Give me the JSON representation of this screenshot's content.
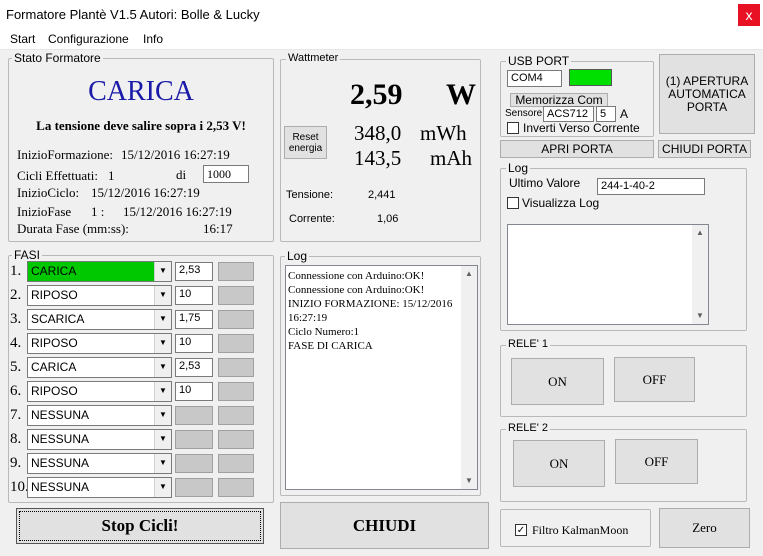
{
  "window": {
    "title": "Formatore Plantè V1.5 Autori: Bolle & Lucky",
    "close": "x"
  },
  "menu": [
    "Start",
    "Configurazione",
    "Info"
  ],
  "stato": {
    "title": "Stato Formatore",
    "status": "CARICA",
    "message": "La tensione deve salire sopra i 2,53 V!",
    "inizio_formazione_label": "InizioFormazione:",
    "inizio_formazione_value": "15/12/2016 16:27:19",
    "cicli_label": "Cicli Effettuati:",
    "cicli_value": "1",
    "cicli_di": "di",
    "cicli_total": "1000",
    "inizio_ciclo_label": "InizioCiclo:",
    "inizio_ciclo_value": "15/12/2016 16:27:19",
    "inizio_fase_label": "InizioFase",
    "inizio_fase_num": "1 :",
    "inizio_fase_value": "15/12/2016 16:27:19",
    "durata_label": "Durata Fase (mm:ss):",
    "durata_value": "16:17"
  },
  "wattmeter": {
    "title": "Wattmeter",
    "power": "2,59",
    "power_unit": "W",
    "reset_label": "Reset energia",
    "energy": "348,0",
    "energy_unit": "mWh",
    "charge": "143,5",
    "charge_unit": "mAh",
    "tensione_label": "Tensione:",
    "tensione_value": "2,441",
    "corrente_label": "Corrente:",
    "corrente_value": "1,06"
  },
  "usb": {
    "title": "USB PORT",
    "port": "COM4",
    "status_color": "#00e000",
    "memorizza": "Memorizza Com",
    "sensore_label": "Sensore",
    "sensore_value": "ACS712",
    "sensore_num": "5",
    "sensore_unit": "A",
    "inverti_label": "Inverti Verso Corrente",
    "apertura_label": "(1) APERTURA AUTOMATICA PORTA",
    "apri_label": "APRI PORTA",
    "chiudi_porta_label": "CHIUDI PORTA"
  },
  "log_right": {
    "title": "Log",
    "ultimo_label": "Ultimo Valore",
    "ultimo_value": "244-1-40-2",
    "visualizza_label": "Visualizza Log"
  },
  "rele1": {
    "title": "RELE' 1",
    "on": "ON",
    "off": "OFF"
  },
  "rele2": {
    "title": "RELE' 2",
    "on": "ON",
    "off": "OFF"
  },
  "fasi": {
    "title": "FASI",
    "rows": [
      {
        "num": "1.",
        "phase": "CARICA",
        "value": "2,53",
        "value_enabled": true,
        "active": true
      },
      {
        "num": "2.",
        "phase": "RIPOSO",
        "value": "10",
        "value_enabled": true,
        "active": false
      },
      {
        "num": "3.",
        "phase": "SCARICA",
        "value": "1,75",
        "value_enabled": true,
        "active": false
      },
      {
        "num": "4.",
        "phase": "RIPOSO",
        "value": "10",
        "value_enabled": true,
        "active": false
      },
      {
        "num": "5.",
        "phase": "CARICA",
        "value": "2,53",
        "value_enabled": true,
        "active": false
      },
      {
        "num": "6.",
        "phase": "RIPOSO",
        "value": "10",
        "value_enabled": true,
        "active": false
      },
      {
        "num": "7.",
        "phase": "NESSUNA",
        "value": "",
        "value_enabled": false,
        "active": false
      },
      {
        "num": "8.",
        "phase": "NESSUNA",
        "value": "",
        "value_enabled": false,
        "active": false
      },
      {
        "num": "9.",
        "phase": "NESSUNA",
        "value": "",
        "value_enabled": false,
        "active": false
      },
      {
        "num": "10.",
        "phase": "NESSUNA",
        "value": "",
        "value_enabled": false,
        "active": false
      }
    ],
    "active_color": "#00c800"
  },
  "log_center": {
    "title": "Log",
    "lines": [
      "Connessione con Arduino:OK!",
      "Connessione con Arduino:OK!",
      "INIZIO FORMAZIONE: 15/12/2016",
      "16:27:19",
      "Ciclo Numero:1",
      "FASE DI CARICA"
    ]
  },
  "bottom": {
    "stop": "Stop Cicli!",
    "chiudi": "CHIUDI",
    "filtro_label": "Filtro KalmanMoon",
    "filtro_checked": "✓",
    "zero": "Zero"
  }
}
